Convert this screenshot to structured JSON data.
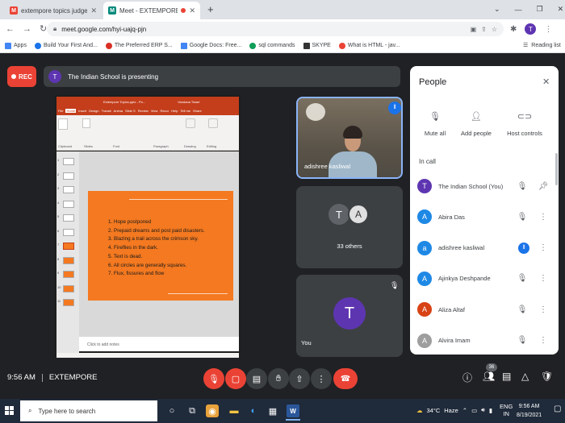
{
  "browser": {
    "tabs": [
      {
        "title": "extempore topics judgement she",
        "favicon": "M",
        "fav_color": "#ea4335"
      },
      {
        "title": "Meet - EXTEMPORE",
        "favicon": "M",
        "fav_color": "#00897b"
      }
    ],
    "new_tab": "+",
    "url": "meet.google.com/hyi-uajq-pjn",
    "bookmarks": [
      {
        "label": "Apps",
        "color": "#4285f4"
      },
      {
        "label": "Build Your First And...",
        "color": "#1a73e8"
      },
      {
        "label": "The Preferred ERP S...",
        "color": "#d93025"
      },
      {
        "label": "Google Docs: Free...",
        "color": "#4285f4"
      },
      {
        "label": "sql commands",
        "color": "#0f9d58"
      },
      {
        "label": "SKYPE",
        "color": "#333333"
      },
      {
        "label": "What is HTML - jav...",
        "color": "#ea4335"
      }
    ],
    "reading_list": "Reading list",
    "profile_initial": "T"
  },
  "meet": {
    "rec_label": "REC",
    "presenter_initial": "T",
    "presenting_text": "The Indian School is presenting",
    "slide": {
      "items": [
        "1. Hope postponed",
        "2. Prepaid dreams and post paid disasters.",
        "3. Blazing a trail across the crimson sky.",
        "4. Fireflies in the dark.",
        "5. Text is dead.",
        "6. All circles are generally squares.",
        "7. Flux, fissures and flow"
      ],
      "notes": "Click to add notes",
      "ppt_title": "Extempore Topics.pptx - Po...",
      "ppt_user": "Vandana Tiwari",
      "ribbon_tabs": [
        "File",
        "Home",
        "Insert",
        "Design",
        "Transit",
        "Anima",
        "Slide S",
        "Review",
        "View",
        "Recor",
        "Help",
        "Tell me",
        "Share"
      ],
      "ribbon_groups": [
        "Clipboard",
        "Slides",
        "Font",
        "Paragraph",
        "Drawing",
        "Editing"
      ],
      "thumb_numbers": [
        "1",
        "2",
        "3",
        "4",
        "5",
        "6",
        "7",
        "8",
        "9",
        "10",
        "11"
      ]
    },
    "tiles": {
      "adi_name": "adishree kasliwal",
      "others_count": "33 others",
      "others_initials": [
        "T",
        "A"
      ],
      "you_label": "You",
      "you_initial": "T"
    },
    "people_panel": {
      "title": "People",
      "actions": [
        "Mute all",
        "Add people",
        "Host controls"
      ],
      "in_call": "In call",
      "participants": [
        {
          "name": "The Indian School (You)",
          "initial": "T",
          "color": "#5e35b1"
        },
        {
          "name": "Abira Das",
          "initial": "A",
          "color": "#1e88e5"
        },
        {
          "name": "adishree kasliwal",
          "initial": "a",
          "color": "#1e88e5"
        },
        {
          "name": "Ajinkya Deshpande",
          "initial": "A",
          "color": "#1e88e5"
        },
        {
          "name": "Aliza Altaf",
          "initial": "A",
          "color": "#d84315"
        },
        {
          "name": "Alvira Imam",
          "initial": "A",
          "color": "#9e9e9e"
        }
      ]
    },
    "bottom": {
      "time": "9:56 AM",
      "meeting_name": "EXTEMPORE",
      "participants_badge": "36"
    }
  },
  "taskbar": {
    "search_placeholder": "Type here to search",
    "temperature": "34°C",
    "weather": "Haze",
    "lang": "ENG",
    "lang2": "IN",
    "time": "9:56 AM",
    "date": "8/19/2021"
  }
}
